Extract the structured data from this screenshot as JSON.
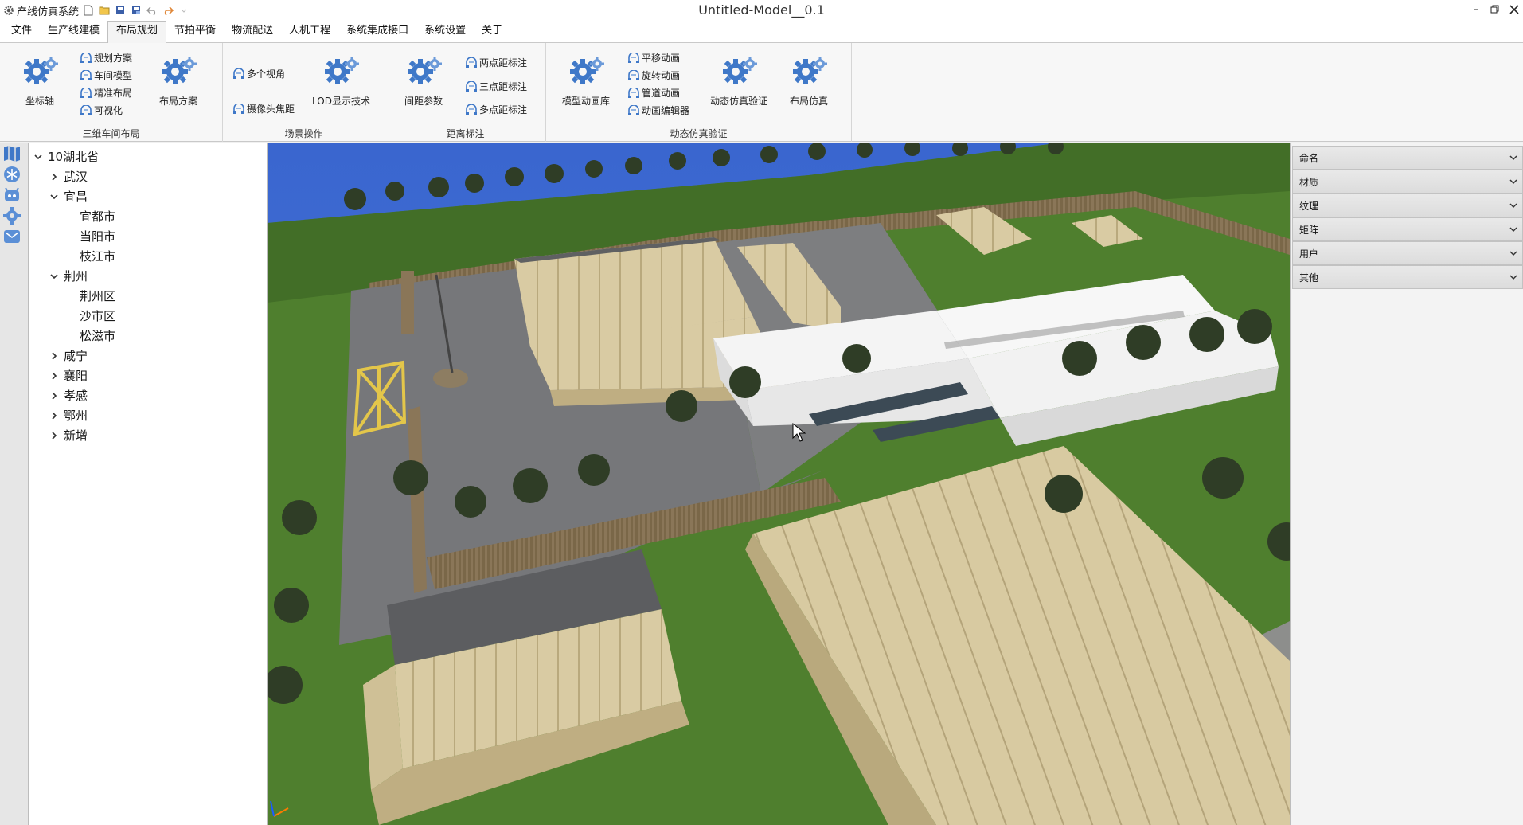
{
  "titlebar": {
    "app_name": "产线仿真系统",
    "window_title": "Untitled-Model__0.1"
  },
  "menu": {
    "items": [
      "文件",
      "生产线建模",
      "布局规划",
      "节拍平衡",
      "物流配送",
      "人机工程",
      "系统集成接口",
      "系统设置",
      "关于"
    ],
    "active_index": 2
  },
  "ribbon": {
    "groups": [
      {
        "title": "三维车间布局",
        "buttons": {
          "coord_axis": "坐标轴",
          "layout_scheme": "布局方案"
        },
        "small": [
          "规划方案",
          "车间模型",
          "精准布局",
          "可视化"
        ]
      },
      {
        "title": "场景操作",
        "small": [
          "多个视角",
          "摄像头焦距"
        ],
        "buttons": {
          "lod": "LOD显示技术"
        }
      },
      {
        "title": "距离标注",
        "buttons": {
          "spacing": "间距参数"
        },
        "small": [
          "两点距标注",
          "三点距标注",
          "多点距标注"
        ]
      },
      {
        "title": "动态仿真验证",
        "buttons": {
          "anim_lib": "模型动画库",
          "dyn_verify": "动态仿真验证",
          "layout_sim": "布局仿真"
        },
        "small": [
          "平移动画",
          "旋转动画",
          "管道动画",
          "动画编辑器"
        ]
      }
    ]
  },
  "tree": {
    "root": "10湖北省",
    "nodes": [
      {
        "label": "武汉",
        "level": 1,
        "state": "collapsed"
      },
      {
        "label": "宜昌",
        "level": 1,
        "state": "expanded"
      },
      {
        "label": "宜都市",
        "level": 2,
        "state": "leaf"
      },
      {
        "label": "当阳市",
        "level": 2,
        "state": "leaf"
      },
      {
        "label": "枝江市",
        "level": 2,
        "state": "leaf"
      },
      {
        "label": "荆州",
        "level": 1,
        "state": "expanded"
      },
      {
        "label": "荆州区",
        "level": 2,
        "state": "leaf"
      },
      {
        "label": "沙市区",
        "level": 2,
        "state": "leaf"
      },
      {
        "label": "松滋市",
        "level": 2,
        "state": "leaf"
      },
      {
        "label": "咸宁",
        "level": 1,
        "state": "collapsed"
      },
      {
        "label": "襄阳",
        "level": 1,
        "state": "collapsed"
      },
      {
        "label": "孝感",
        "level": 1,
        "state": "collapsed"
      },
      {
        "label": "鄂州",
        "level": 1,
        "state": "collapsed"
      },
      {
        "label": "新增",
        "level": 1,
        "state": "collapsed"
      }
    ]
  },
  "properties": {
    "sections": [
      "命名",
      "材质",
      "纹理",
      "矩阵",
      "用户",
      "其他"
    ]
  },
  "left_strip": {
    "icons": [
      "map-icon",
      "snowflake-icon",
      "robot-icon",
      "gear-icon",
      "mail-icon"
    ]
  },
  "colors": {
    "gear_blue": "#3f78c8",
    "grass": "#4f7f2e",
    "sky": "#3e6fd1",
    "tan_roof": "#d6c79d",
    "asphalt": "#76777a"
  }
}
